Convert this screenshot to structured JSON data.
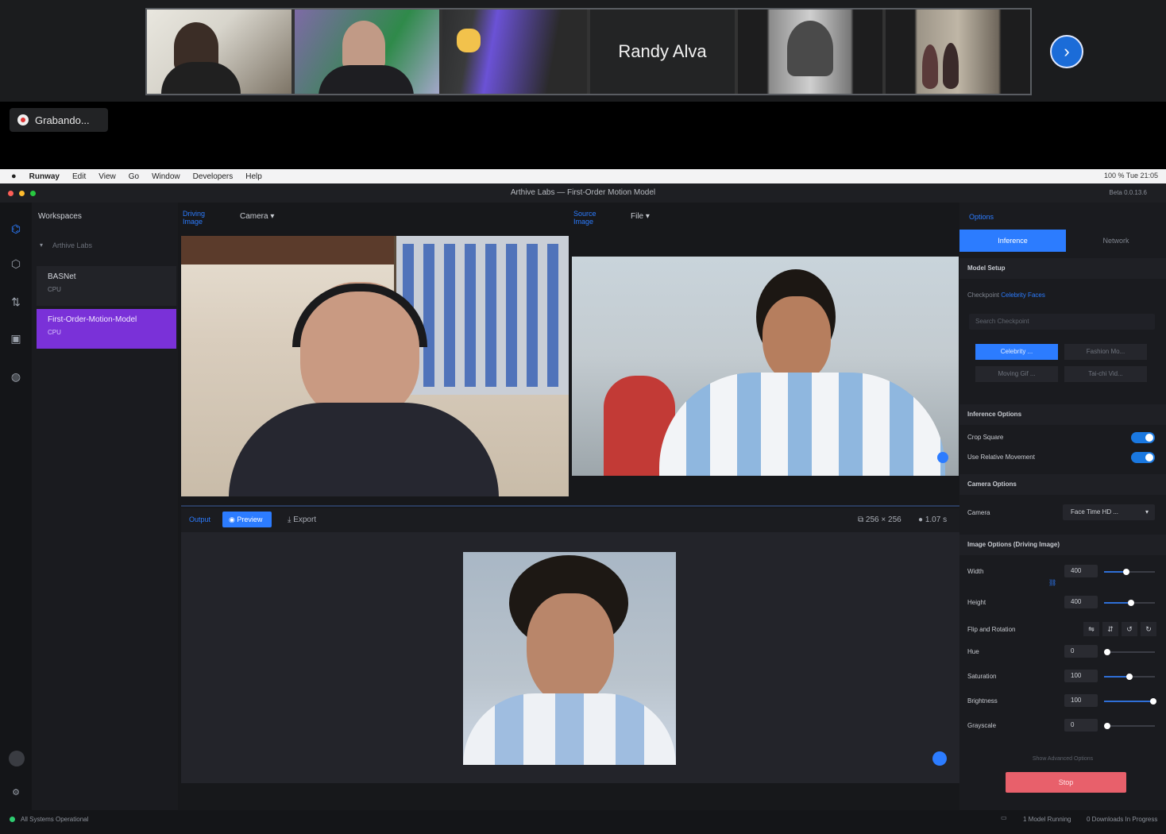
{
  "zoom": {
    "participants": [
      {
        "name": ""
      },
      {
        "name": ""
      },
      {
        "name": ""
      },
      {
        "name": "Randy Alva"
      },
      {
        "name": ""
      },
      {
        "name": ""
      }
    ],
    "recording_label": "Grabando..."
  },
  "menubar": {
    "app": "Runway",
    "items": [
      "Edit",
      "View",
      "Go",
      "Window",
      "Developers",
      "Help"
    ],
    "status_right": "100 %   Tue 21:05"
  },
  "window": {
    "title": "Arthive Labs — First-Order Motion Model",
    "version": "Beta 0.0.13.6"
  },
  "workspace": {
    "header": "Workspaces",
    "folder": "Arthive Labs",
    "items": [
      {
        "label": "BASNet",
        "sub": "CPU"
      },
      {
        "label": "First-Order-Motion-Model",
        "sub": "CPU"
      }
    ]
  },
  "driving": {
    "tab": "Driving Image",
    "source_select": "Camera"
  },
  "source": {
    "tab": "Source Image",
    "source_select": "File"
  },
  "output": {
    "tab": "Output",
    "preview": "Preview",
    "export": "Export",
    "size": "256 × 256",
    "fps": "1.07 s"
  },
  "options": {
    "header": "Options",
    "tabs": [
      "Inference",
      "Network"
    ],
    "model_setup": "Model Setup",
    "checkpoint_label": "Checkpoint",
    "checkpoint_value": "Celebrity Faces",
    "search_placeholder": "Search Checkpoint",
    "checkpoints": [
      "Celebrity ...",
      "Fashion Mo...",
      "Moving Gif ...",
      "Tai-chi Vid..."
    ],
    "inference_options": "Inference Options",
    "crop_square": "Crop Square",
    "use_relative": "Use Relative Movement",
    "camera_options": "Camera Options",
    "camera_label": "Camera",
    "camera_value": "Face Time HD ...",
    "image_options": "Image Options (Driving Image)",
    "width_label": "Width",
    "width_value": "400",
    "height_label": "Height",
    "height_value": "400",
    "flip_label": "Flip and Rotation",
    "hue_label": "Hue",
    "hue_value": "0",
    "saturation_label": "Saturation",
    "saturation_value": "100",
    "brightness_label": "Brightness",
    "brightness_value": "100",
    "grayscale_label": "Grayscale",
    "grayscale_value": "0",
    "advanced_link": "Show Advanced Options",
    "stop_button": "Stop"
  },
  "status": {
    "left": "All Systems Operational",
    "models": "1 Model Running",
    "downloads": "0 Downloads In Progress"
  },
  "colors": {
    "accent_blue": "#2c7cff",
    "active_purple": "#7a31d8",
    "stop_red": "#e8606b",
    "zoom_blue": "#1b6cd8"
  }
}
